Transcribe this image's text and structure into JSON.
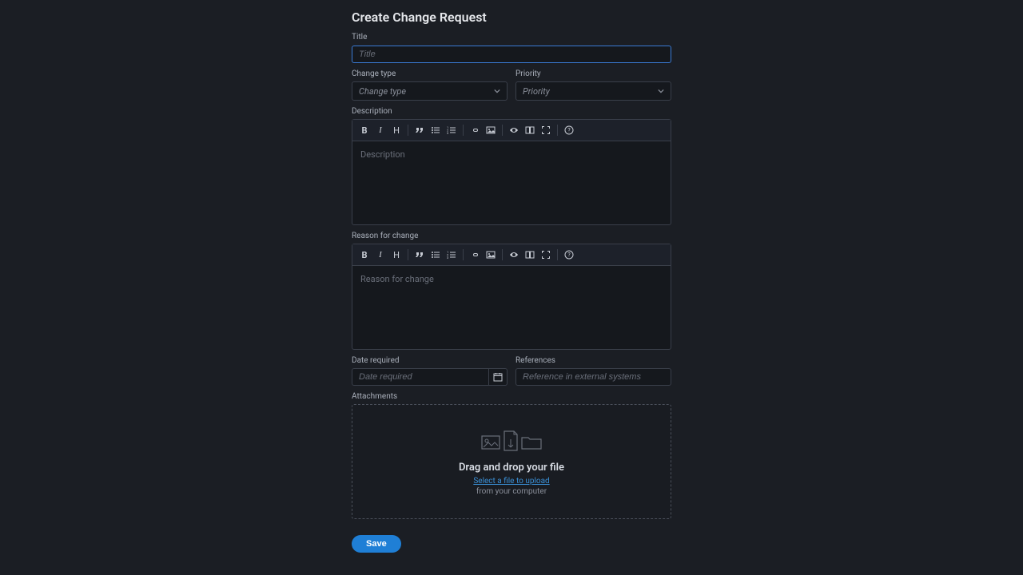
{
  "page": {
    "title": "Create Change Request"
  },
  "fields": {
    "title": {
      "label": "Title",
      "placeholder": "Title"
    },
    "change_type": {
      "label": "Change type",
      "placeholder": "Change type"
    },
    "priority": {
      "label": "Priority",
      "placeholder": "Priority"
    },
    "description": {
      "label": "Description",
      "placeholder": "Description"
    },
    "reason": {
      "label": "Reason for change",
      "placeholder": "Reason for change"
    },
    "date_required": {
      "label": "Date required",
      "placeholder": "Date required"
    },
    "references": {
      "label": "References",
      "placeholder": "Reference in external systems"
    },
    "attachments": {
      "label": "Attachments"
    }
  },
  "dropzone": {
    "title": "Drag and drop your file",
    "link": "Select a file to upload",
    "sub": "from your computer"
  },
  "buttons": {
    "save": "Save"
  },
  "toolbar": {
    "bold": "B",
    "italic": "I",
    "heading": "H"
  }
}
